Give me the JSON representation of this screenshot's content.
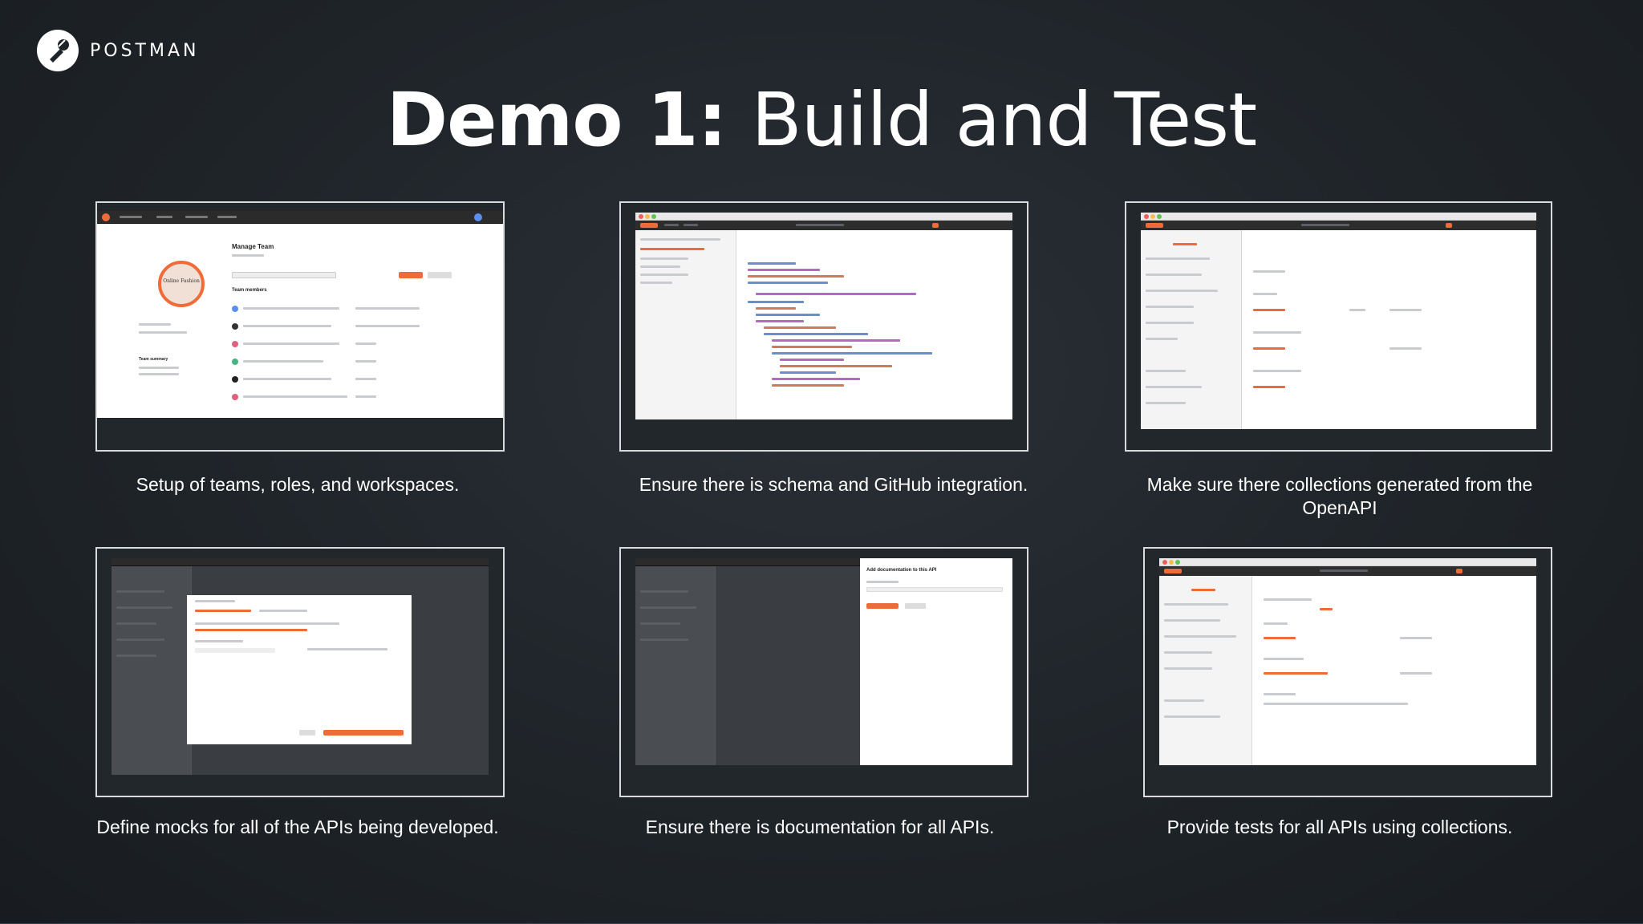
{
  "brand": {
    "name": "POSTMAN"
  },
  "title": {
    "bold": "Demo 1:",
    "light": "Build and Test"
  },
  "cards": [
    {
      "caption": "Setup of teams, roles, and workspaces."
    },
    {
      "caption": "Ensure there is schema and GitHub integration."
    },
    {
      "caption": "Make sure there collections generated from the OpenAPI"
    },
    {
      "caption": "Define mocks for all of the APIs being developed."
    },
    {
      "caption": "Ensure there is documentation for all APIs."
    },
    {
      "caption": "Provide tests for all APIs using collections."
    }
  ],
  "screens": {
    "team": {
      "heading": "Manage Team",
      "members_label": "Team members",
      "summary_label": "Team summary",
      "org_name": "Online Fashion"
    },
    "docs": {
      "modal_title": "Add documentation to this API"
    }
  },
  "colors": {
    "accent": "#ef6c3a",
    "background": "#1f2429",
    "text": "#ffffff"
  },
  "icons": {
    "logo": "postman-astronaut-icon"
  }
}
